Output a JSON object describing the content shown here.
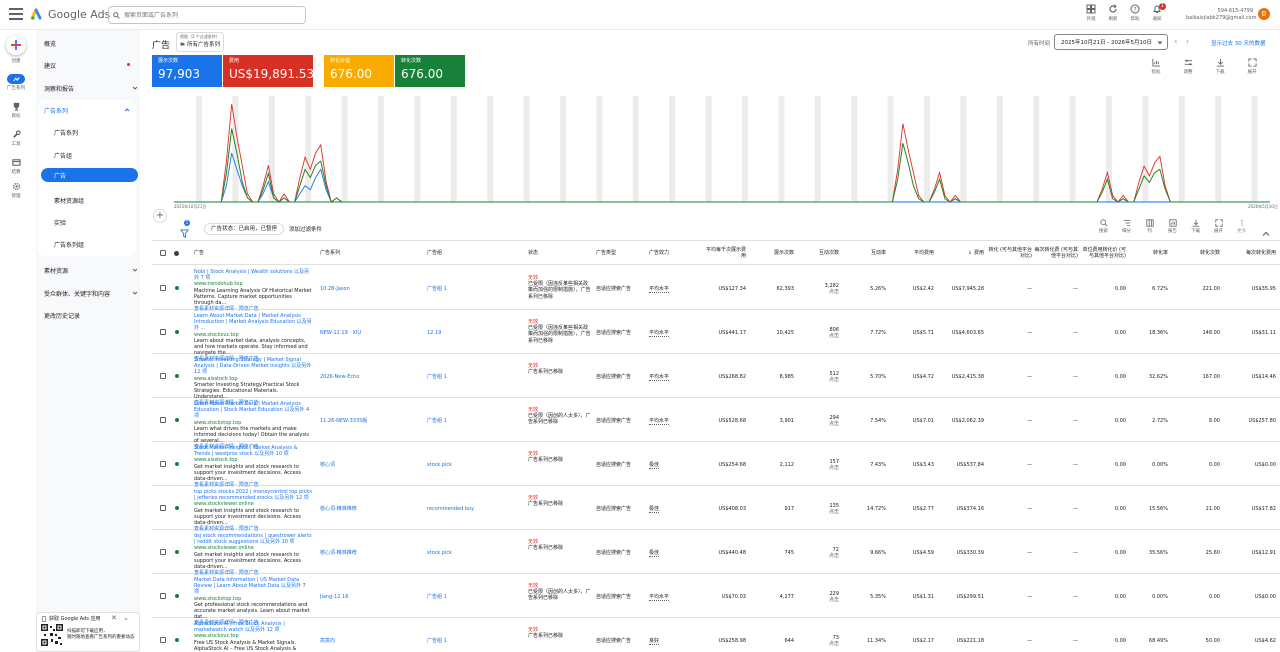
{
  "header": {
    "logo_text": "Google Ads",
    "search_placeholder": "搜索页面或广告系列",
    "tools": [
      "外观",
      "刷新",
      "帮助",
      "通知"
    ],
    "notification_count": "1",
    "account_id": "594-615-4799",
    "account_email": "baikaixjiabk279@gmail.com",
    "avatar_letter": "B"
  },
  "rail": {
    "create_label": "创建",
    "items": [
      "广告系列",
      "目标",
      "工具",
      "结算",
      "管理"
    ]
  },
  "nav": {
    "items": [
      "概览",
      "建议",
      "洞察和报告"
    ],
    "section": "广告系列",
    "sub": [
      "广告系列",
      "广告组",
      "广告",
      "素材资源组",
      "实验",
      "广告系列组"
    ],
    "bottom": [
      "素材资源",
      "受众群体、关键字和内容",
      "更改历史记录"
    ]
  },
  "qr": {
    "title": "获取 Google Ads 应用",
    "line1": "扫描即可下载应用，",
    "line2": "随时随地查看广告系列的重要动态"
  },
  "page": {
    "title": "广告",
    "filter_hint": "视图（2 个过滤条件）",
    "filter_value": "所有广告系列",
    "date_label": "所有时间",
    "date_range": "2025年10月21日 - 2026年5月10日",
    "range_link": "显示过去 30 天的数据"
  },
  "metrics": [
    {
      "label": "展示次数",
      "value": "97,903",
      "color": "#1a73e8"
    },
    {
      "label": "费用",
      "value": "US$19,891.53",
      "color": "#d93025"
    },
    {
      "label": "转化价值",
      "value": "676.00",
      "color": "#f9ab00"
    },
    {
      "label": "转化次数",
      "value": "676.00",
      "color": "#188038"
    }
  ],
  "chart_tools": [
    "指标",
    "调整",
    "下载",
    "展开"
  ],
  "chart_axis": {
    "start": "2025年10月21日",
    "end": "2026年5月10日"
  },
  "chart_data": {
    "type": "line",
    "series": [
      {
        "name": "展示次数",
        "color": "#1a73e8",
        "values": [
          0,
          0,
          0,
          0,
          0,
          0,
          0,
          0,
          0,
          0,
          4,
          12,
          8,
          4,
          1,
          0,
          0,
          2,
          5,
          1,
          0,
          1,
          0,
          0,
          2,
          4,
          3,
          6,
          8,
          3,
          0,
          1,
          0,
          0,
          0,
          0,
          0,
          0,
          0,
          0,
          0,
          0,
          0,
          0,
          0,
          0,
          0,
          0,
          0,
          0,
          0,
          0,
          0,
          0,
          0,
          0,
          0,
          0,
          0,
          0,
          0,
          0,
          0,
          0,
          0,
          0,
          0,
          0,
          0,
          0,
          0,
          0,
          0,
          0,
          0,
          0,
          0,
          0,
          0,
          0,
          0,
          0,
          0,
          0,
          0,
          0,
          0,
          0,
          0,
          0,
          0,
          0,
          0,
          0,
          0,
          0,
          0,
          0,
          0,
          0,
          0,
          0,
          0,
          0,
          0,
          0,
          0,
          0,
          0,
          0,
          0,
          0,
          0,
          0,
          0,
          0,
          0,
          0,
          0,
          0,
          0,
          0,
          0,
          0,
          0,
          0,
          0,
          0,
          0,
          0,
          0,
          0,
          0,
          0,
          0,
          0,
          0,
          0,
          0,
          0,
          0,
          0,
          0,
          0,
          0,
          0,
          0,
          0,
          0,
          0,
          0,
          0,
          0,
          0,
          0,
          0,
          0,
          0,
          0,
          0,
          0,
          0,
          0,
          0,
          0,
          0,
          0,
          0,
          0,
          0,
          0,
          0,
          0,
          0,
          0,
          0,
          0,
          0,
          0,
          0,
          0,
          0,
          0,
          0,
          0,
          0,
          0,
          0,
          0,
          0,
          0,
          0,
          0,
          0,
          0,
          0,
          0,
          0,
          0,
          0,
          0,
          0,
          0,
          0,
          0,
          0,
          0,
          0,
          0,
          0,
          0,
          0,
          0
        ]
      },
      {
        "name": "费用",
        "color": "#d93025",
        "values": [
          0,
          0,
          0,
          0,
          0,
          0,
          0,
          0,
          0,
          0,
          10,
          24,
          16,
          9,
          2,
          0,
          0,
          4,
          9,
          2,
          0,
          2,
          0,
          0,
          6,
          11,
          8,
          12,
          14,
          5,
          0,
          1
        ]
      },
      {
        "name": "转化价值",
        "color": "#f9ab00",
        "values": [
          0,
          0,
          0,
          0,
          0,
          0,
          0,
          0,
          0,
          0,
          7,
          18,
          12,
          5,
          1,
          0,
          0,
          3,
          7,
          1,
          0,
          1,
          0,
          0,
          4,
          8,
          6,
          9,
          10,
          4,
          0,
          1
        ]
      },
      {
        "name": "转化次数",
        "color": "#188038",
        "values": [
          0,
          0,
          0,
          0,
          0,
          0,
          0,
          0,
          0,
          0,
          7,
          18,
          12,
          5,
          1,
          0,
          0,
          3,
          7,
          1,
          0,
          1,
          0,
          0,
          4,
          8,
          6,
          9,
          10,
          4,
          0,
          1
        ]
      }
    ],
    "xlabel": "",
    "ylabel": "",
    "ylim": [
      0,
      26
    ]
  },
  "table": {
    "filter_chip": "广告状态：已启用，已暂停",
    "add_filter": "添加过滤条件",
    "tools": [
      "搜索",
      "细分",
      "列",
      "报告",
      "下载",
      "展开",
      "更多"
    ],
    "headers": [
      "广告",
      "广告系列",
      "广告组",
      "状态",
      "广告类型",
      "广告效力",
      "平均每千次展示费用",
      "展示次数",
      "互动次数",
      "互动率",
      "平均费用",
      "费用",
      "转化 (可与其他平台对比)",
      "每次转化费 (可与其他平台对比)",
      "单位费用转化价 (可与其他平台对比)",
      "转化率",
      "转化次数",
      "每次转化费用"
    ],
    "rows": [
      {
        "title": "Nobi | Stock Analysis | Wealth solutions  以及另外 7 项",
        "url": "www.trendshub.top",
        "desc": "Machine Learning Analysis Of Historical Market Patterns.  Capture market opportunities through da...",
        "links": "查看素材资源详情 · 预览广告",
        "campaign": "10.28-Jason",
        "adgroup": "广告组 1",
        "status": [
          "无效",
          "已受限（因违反某些相关政",
          "策而加强的限制措施），广告",
          "系列已移除"
        ],
        "type": "自适应搜索广告",
        "strength": "平均水平",
        "cpm": "US$127.34",
        "impr": "62,393",
        "inter": "3,282",
        "inter_sub": "点击",
        "rate": "5.26%",
        "avgcost": "US$2.42",
        "cost": "US$7,945.28",
        "c1": "—",
        "c2": "—",
        "c3": "0.00",
        "cvr": "6.72%",
        "conv": "221.00",
        "cpa": "US$35.95"
      },
      {
        "title": "Learn About Market Data | Market Analysis Introduction | Market Analysis Education  以及另外 ...",
        "url": "www.stocksvz.top",
        "desc": "Learn about market data, analysis concepts, and how markets operate.  Stay informed and navigate the...",
        "links": "查看素材资源详情 · 预览广告",
        "campaign": "NEW-12.19 · XIU",
        "adgroup": "12.19",
        "status": [
          "无效",
          "已受限（因违反某些相关政",
          "策而加强的限制措施），广告",
          "系列已移除"
        ],
        "type": "自适应搜索广告",
        "strength": "平均水平",
        "cpm": "US$441.17",
        "impr": "10,425",
        "inter": "806",
        "inter_sub": "点击",
        "rate": "7.72%",
        "avgcost": "US$5.71",
        "cost": "US$4,603.65",
        "c1": "—",
        "c2": "—",
        "c3": "0.00",
        "cvr": "18.36%",
        "conv": "148.00",
        "cpa": "US$31.11"
      },
      {
        "title": "Smarter Investing Strategy | Market Signal Analysis | Data-Driven Market Insights  以及另外 12 项",
        "url": "www.aisstock.top",
        "desc": "Smarter Investing Strategy.Practical Stock Strategies.  Educational Materials. Understand...",
        "links": "查看素材资源详情 · 预览广告",
        "campaign": "2026-New-Echo",
        "adgroup": "广告组 1",
        "status": [
          "无效",
          "广告系列已移除"
        ],
        "type": "自适应搜索广告",
        "strength": "平均水平",
        "cpm": "US$268.82",
        "impr": "8,985",
        "inter": "512",
        "inter_sub": "点击",
        "rate": "5.70%",
        "avgcost": "US$4.72",
        "cost": "US$2,415.38",
        "c1": "—",
        "c2": "—",
        "c3": "0.00",
        "cvr": "32.62%",
        "conv": "167.00",
        "cpa": "US$14.46"
      },
      {
        "title": "Learn About Market Data | Market Analysis Education | Stock Market Education  以及另外 4 项",
        "url": "www.stockstop.top",
        "desc": "Learn what drives the markets and make informed decisions today! Obtain the analysis of several...",
        "links": "查看素材资源详情 · 预览广告",
        "campaign": "11.26-NEW-3335版",
        "adgroup": "广告组 1",
        "status": [
          "无效",
          "已受限（因创的人太多），广",
          "告系列已移除"
        ],
        "type": "自适应搜索广告",
        "strength": "平均水平",
        "cpm": "US$528.68",
        "impr": "3,901",
        "inter": "294",
        "inter_sub": "点击",
        "rate": "7.54%",
        "avgcost": "US$7.01",
        "cost": "US$2,062.39",
        "c1": "—",
        "c2": "—",
        "c3": "0.00",
        "cvr": "2.72%",
        "conv": "8.00",
        "cpa": "US$257.80"
      },
      {
        "title": "Stock Market Insights | Market Analysis & Trends | westpros stock  以及另外 10 项",
        "url": "www.aisstock.top",
        "desc": "Get market insights and stock research to support your investment decisions. Access data-driven...",
        "links": "查看素材资源详情 · 预览广告",
        "campaign": "核心词",
        "adgroup": "stock pick",
        "status": [
          "无效",
          "广告系列已移除"
        ],
        "type": "自适应搜索广告",
        "strength": "极佳",
        "cpm": "US$254.68",
        "impr": "2,112",
        "inter": "157",
        "inter_sub": "点击",
        "rate": "7.43%",
        "avgcost": "US$3.43",
        "cost": "US$537.84",
        "c1": "—",
        "c2": "—",
        "c3": "0.00",
        "cvr": "0.00%",
        "conv": "0.00",
        "cpa": "US$0.00"
      },
      {
        "title": "top picks stocks 2022 | moneycontrol top picks | jefferies recommended stocks  以及另外 12 项",
        "url": "www.stockviewer.online",
        "desc": "Get market insights and stock research to support your investment decisions. Access data-driven...",
        "links": "查看素材资源详情 · 预览广告",
        "campaign": "核心词-精准推荐",
        "adgroup": "recommended buy",
        "status": [
          "无效",
          "广告系列已移除"
        ],
        "type": "自适应搜索广告",
        "strength": "极佳",
        "cpm": "US$408.03",
        "impr": "917",
        "inter": "135",
        "inter_sub": "点击",
        "rate": "14.72%",
        "avgcost": "US$2.77",
        "cost": "US$374.16",
        "c1": "—",
        "c2": "—",
        "c3": "0.00",
        "cvr": "15.56%",
        "conv": "21.00",
        "cpa": "US$17.82"
      },
      {
        "title": "dsj stock recommendations | questrower alerts | reddit stock suggestions  以及另外 10 项",
        "url": "www.stockviewer.online",
        "desc": "Get market insights and stock research to support your investment decisions. Access data-driven...",
        "links": "查看素材资源详情 · 预览广告",
        "campaign": "核心词-精准推荐",
        "adgroup": "stock pick",
        "status": [
          "无效",
          "广告系列已移除"
        ],
        "type": "自适应搜索广告",
        "strength": "极佳",
        "cpm": "US$440.48",
        "impr": "745",
        "inter": "72",
        "inter_sub": "点击",
        "rate": "9.66%",
        "avgcost": "US$4.59",
        "cost": "US$330.39",
        "c1": "—",
        "c2": "—",
        "c3": "0.00",
        "cvr": "35.56%",
        "conv": "25.60",
        "cpa": "US$12.91"
      },
      {
        "title": "Market Data Information | US Market Data Review | Learn About Market Data  以及另外 7 项",
        "url": "www.stockstop.top",
        "desc": "Get professional stock recommendations and accurate market analysis.  Learn about market dat...",
        "links": "查看素材资源详情 · 预览广告",
        "campaign": "Jiang-12.16",
        "adgroup": "广告组 1",
        "status": [
          "无效",
          "已受限（因创的人太多），广",
          "告系列已移除"
        ],
        "type": "自适应搜索广告",
        "strength": "平均水平",
        "cpm": "US$70.03",
        "impr": "4,277",
        "inter": "229",
        "inter_sub": "点击",
        "rate": "5.35%",
        "avgcost": "US$1.31",
        "cost": "US$299.51",
        "c1": "—",
        "c2": "—",
        "c3": "0.00",
        "cvr": "0.00%",
        "conv": "0.00",
        "cpa": "US$0.00"
      },
      {
        "title": "AlphaStock AI | Free Stock Analysis | marketwatch watch  以及另外 12 项",
        "url": "www.stocksvz.top",
        "desc": "Free US Stock Analysis & Market Signals.  AlphaStock AI – Free US Stock Analysis & Market...",
        "links": "查看素材资源详情 · 预览广告",
        "campaign": "高意向",
        "adgroup": "广告组 1",
        "status": [
          "无效",
          "广告系列已移除"
        ],
        "type": "自适应搜索广告",
        "strength": "良好",
        "cpm": "US$258.98",
        "impr": "644",
        "inter": "73",
        "inter_sub": "点击",
        "rate": "11.34%",
        "avgcost": "US$2.17",
        "cost": "US$221.18",
        "c1": "—",
        "c2": "—",
        "c3": "0.00",
        "cvr": "68.49%",
        "conv": "50.00",
        "cpa": "US$4.62"
      }
    ]
  }
}
